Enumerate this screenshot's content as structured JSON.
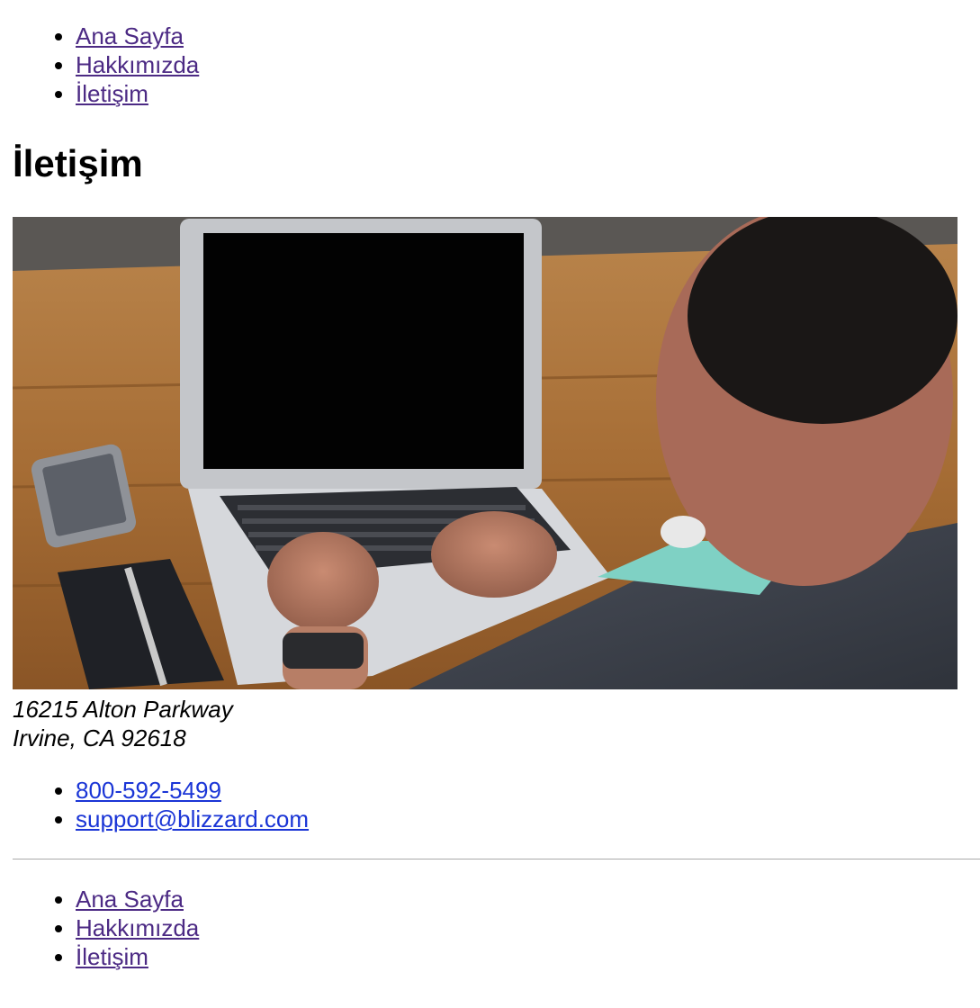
{
  "nav_top": {
    "items": [
      {
        "label": "Ana Sayfa"
      },
      {
        "label": "Hakkımızda"
      },
      {
        "label": "İletişim"
      }
    ]
  },
  "page_title": "İletişim",
  "address": {
    "line1": "16215 Alton Parkway",
    "line2": "Irvine, CA 92618"
  },
  "contact": {
    "phone": "800-592-5499",
    "email": "support@blizzard.com"
  },
  "nav_bottom": {
    "items": [
      {
        "label": "Ana Sayfa"
      },
      {
        "label": "Hakkımızda"
      },
      {
        "label": "İletişim"
      }
    ]
  },
  "colors": {
    "visited_link": "#4c2a84",
    "link": "#1a35d6"
  }
}
